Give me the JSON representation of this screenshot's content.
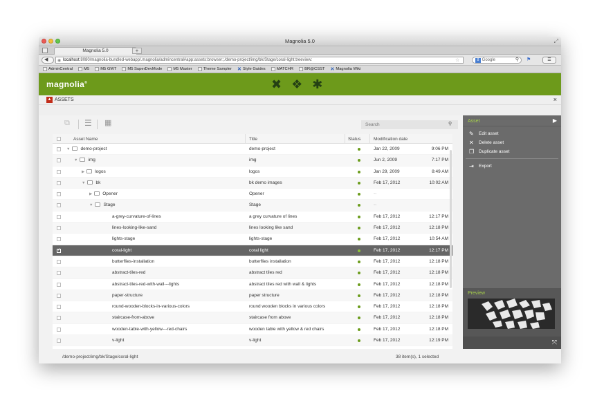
{
  "browser": {
    "window_title": "Magnolia 5.0",
    "tab_label": "Magnolia 5.0",
    "url_host": "localhost",
    "url_rest": ":8080/magnolia-bundled-webapp/.magnolia/admincentral#app:assets:browser:;/demo-project/img/bk/Stage/coral-light:treeview:",
    "search_engine": "Google",
    "bookmarks": [
      "AdminCentral",
      "M5",
      "M5 GWT",
      "M5 SuperDevMode",
      "M5 Master",
      "Theme Sampler",
      "Style Guides",
      "MATCHR",
      "BR@CSST",
      "Magnolia Wiki"
    ]
  },
  "header": {
    "logo": "magnolia",
    "app_icons": [
      "x-app-icon",
      "pattern-app-icon",
      "asterisk-app-icon"
    ]
  },
  "app": {
    "name": "ASSETS",
    "close": "×"
  },
  "toolbar": {
    "search_placeholder": "Search"
  },
  "grid": {
    "columns": {
      "name": "Asset Name",
      "title": "Title",
      "status": "Status",
      "date": "Modification date"
    },
    "rows": [
      {
        "name": "demo-project",
        "title": "demo-project",
        "date": "Jan 22, 2009",
        "time": "9:06 PM",
        "level": 0,
        "type": "folder",
        "open": true
      },
      {
        "name": "img",
        "title": "img",
        "date": "Jun 2, 2009",
        "time": "7:17 PM",
        "level": 1,
        "type": "folder",
        "open": true
      },
      {
        "name": "logos",
        "title": "logos",
        "date": "Jan 29, 2009",
        "time": "8:49 AM",
        "level": 2,
        "type": "folder",
        "open": false
      },
      {
        "name": "bk",
        "title": "bk demo images",
        "date": "Feb 17, 2012",
        "time": "10:02 AM",
        "level": 2,
        "type": "folder",
        "open": true
      },
      {
        "name": "Opener",
        "title": "Opener",
        "date": "--",
        "time": "",
        "level": 3,
        "type": "folder",
        "open": false
      },
      {
        "name": "Stage",
        "title": "Stage",
        "date": "--",
        "time": "",
        "level": 3,
        "type": "folder",
        "open": true
      },
      {
        "name": "a-grey-curvature-of-lines",
        "title": "a grey curvature of lines",
        "date": "Feb 17, 2012",
        "time": "12:17 PM",
        "level": 4,
        "type": "asset"
      },
      {
        "name": "lines-looking-like-sand",
        "title": "lines looking like sand",
        "date": "Feb 17, 2012",
        "time": "12:18 PM",
        "level": 4,
        "type": "asset"
      },
      {
        "name": "lights-stage",
        "title": "lights-stage",
        "date": "Feb 17, 2012",
        "time": "10:54 AM",
        "level": 4,
        "type": "asset"
      },
      {
        "name": "coral-light",
        "title": "coral light",
        "date": "Feb 17, 2012",
        "time": "12:17 PM",
        "level": 4,
        "type": "asset",
        "selected": true
      },
      {
        "name": "butterflies-installation",
        "title": "butterflies installation",
        "date": "Feb 17, 2012",
        "time": "12:18 PM",
        "level": 4,
        "type": "asset"
      },
      {
        "name": "abstract-tiles-red",
        "title": "abstract tiles red",
        "date": "Feb 17, 2012",
        "time": "12:18 PM",
        "level": 4,
        "type": "asset"
      },
      {
        "name": "abstract-tiles-red-with-wall---lights",
        "title": "abstract tiles red with wall & lights",
        "date": "Feb 17, 2012",
        "time": "12:18 PM",
        "level": 4,
        "type": "asset"
      },
      {
        "name": "paper-structure",
        "title": "paper structure",
        "date": "Feb 17, 2012",
        "time": "12:18 PM",
        "level": 4,
        "type": "asset"
      },
      {
        "name": "round-wooden-blocks-in-various-colors",
        "title": "round wooden blocks in various colors",
        "date": "Feb 17, 2012",
        "time": "12:18 PM",
        "level": 4,
        "type": "asset"
      },
      {
        "name": "staircase-from-above",
        "title": "staircase from above",
        "date": "Feb 17, 2012",
        "time": "12:18 PM",
        "level": 4,
        "type": "asset"
      },
      {
        "name": "wooden-table-with-yellow---red-chairs",
        "title": "wooden table with yellow & red chairs",
        "date": "Feb 17, 2012",
        "time": "12:18 PM",
        "level": 4,
        "type": "asset"
      },
      {
        "name": "v-light",
        "title": "v-light",
        "date": "Feb 17, 2012",
        "time": "12:19 PM",
        "level": 4,
        "type": "asset"
      }
    ]
  },
  "footer": {
    "path": "/demo-project/img/bk/Stage/coral-light",
    "count": "38 item(s), 1 selected"
  },
  "actionbar": {
    "section": "Asset",
    "items": [
      {
        "label": "Edit asset",
        "icon": "pencil-icon"
      },
      {
        "label": "Delete asset",
        "icon": "delete-icon"
      },
      {
        "label": "Duplicate asset",
        "icon": "duplicate-icon"
      },
      {
        "label": "Export",
        "icon": "export-icon"
      }
    ],
    "preview_label": "Preview"
  },
  "colors": {
    "brand_green": "#6d9a1b",
    "accent_green": "#a7d14a",
    "status_published": "#6b9c1c",
    "selected_row": "#656565",
    "actionbar_bg": "#6b6b6b"
  }
}
